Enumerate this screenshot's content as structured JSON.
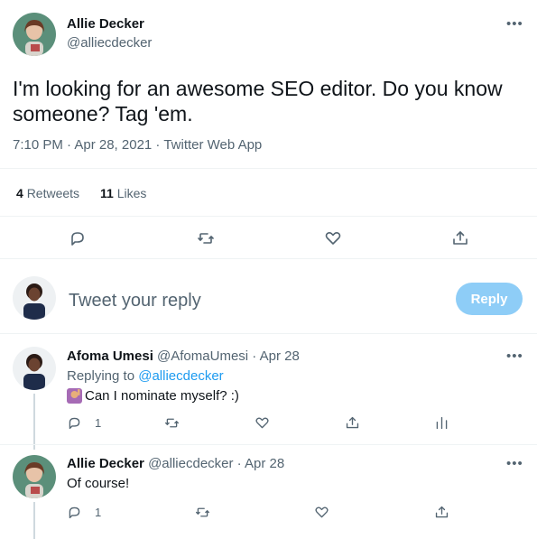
{
  "tweet": {
    "author_name": "Allie Decker",
    "author_handle": "@alliecdecker",
    "text_line1": "I'm looking for an awesome SEO editor. Do you know",
    "text_line2": "someone? Tag 'em.",
    "meta": "7:10 PM · Apr 28, 2021 · Twitter Web App",
    "retweets_count": "4",
    "retweets_label": "Retweets",
    "likes_count": "11",
    "likes_label": "Likes"
  },
  "compose": {
    "placeholder": "Tweet your reply",
    "reply_label": "Reply"
  },
  "replies": [
    {
      "author_name": "Afoma Umesi",
      "author_handle": "@AfomaUmesi",
      "date": "· Apr 28",
      "replying_prefix": "Replying to",
      "replying_handle": "@alliecdecker",
      "text": "Can I nominate myself? :)",
      "reply_count": "1"
    },
    {
      "author_name": "Allie Decker",
      "author_handle": "@alliecdecker",
      "date": "· Apr 28",
      "text": "Of course!",
      "reply_count": "1"
    }
  ],
  "icons": {
    "more": "more-horizontal-icon",
    "reply": "speech-bubble-icon",
    "retweet": "retweet-arrows-icon",
    "like": "heart-icon",
    "share": "share-upload-icon",
    "analytics": "bar-chart-icon",
    "emoji": "raising-hand-emoji"
  },
  "colors": {
    "accent": "#1d9bf0",
    "reply_button": "#8ecdf7",
    "secondary_text": "#536471"
  }
}
